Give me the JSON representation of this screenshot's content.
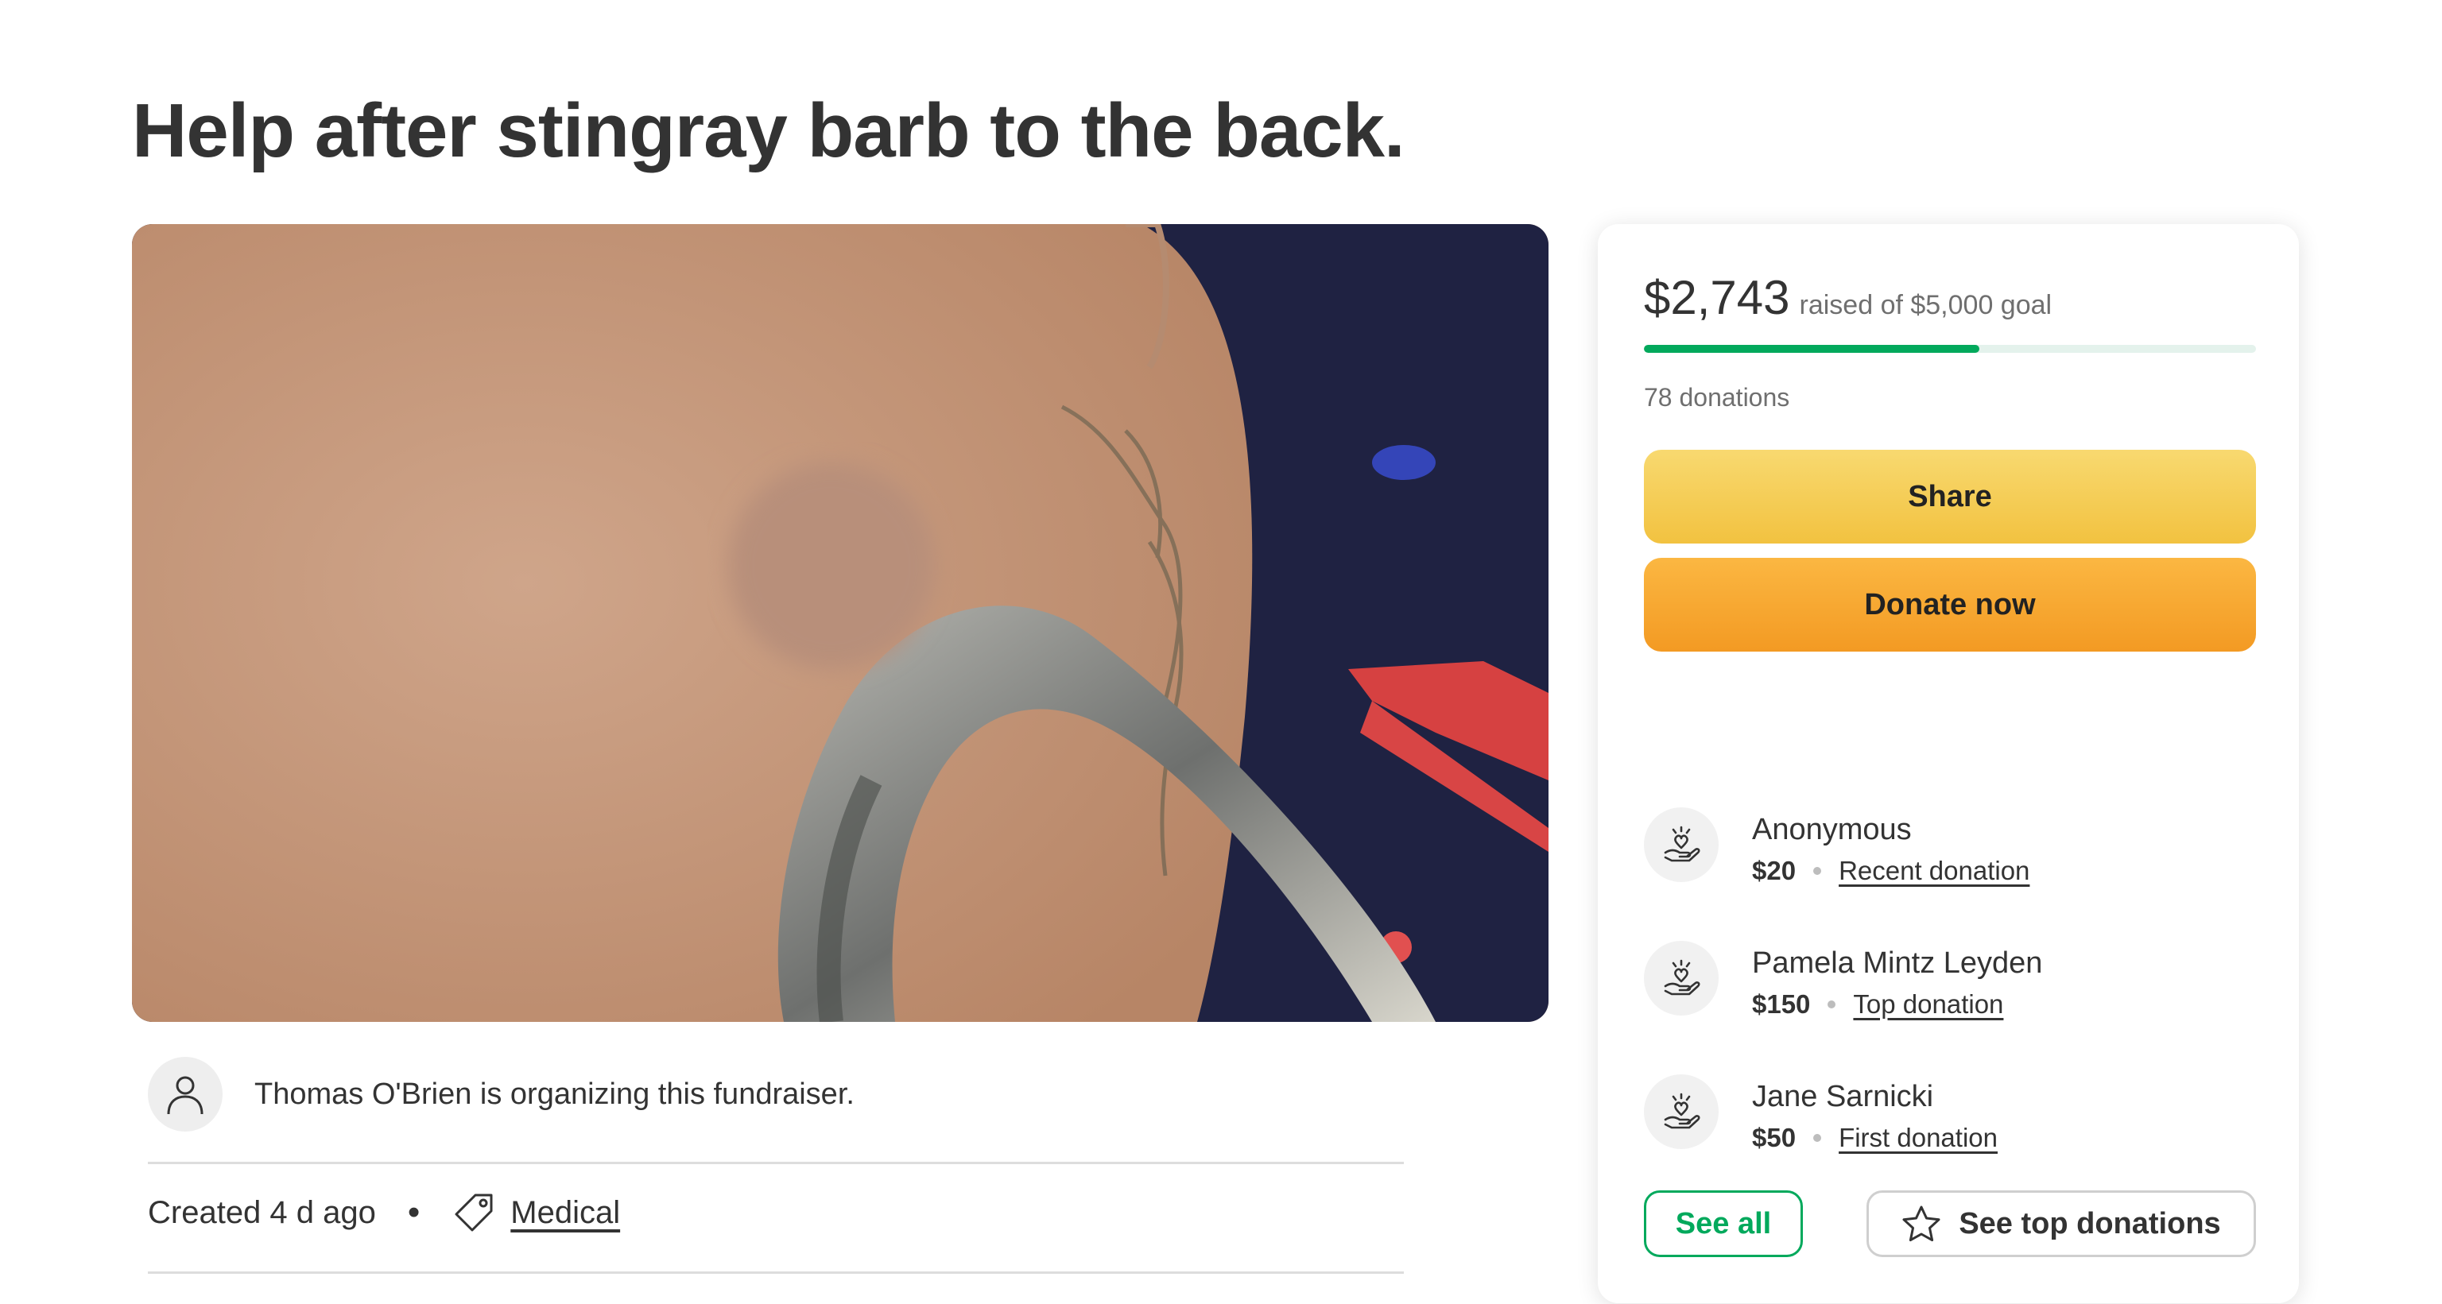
{
  "page": {
    "title": "Help after stingray barb to the back."
  },
  "hero": {
    "alt": "stingray barb photo",
    "colors": {
      "skin": "#c99d82",
      "background": "#1e2140",
      "barb": "#8a8c8a",
      "rail": "#d84040"
    }
  },
  "organizer": {
    "text": "Thomas O'Brien is organizing this fundraiser.",
    "icon": "person-icon"
  },
  "meta": {
    "created": "Created 4 d ago",
    "separator": "•",
    "category": "Medical",
    "category_icon": "tag-icon"
  },
  "donation_card": {
    "raised_amount": "$2,743",
    "raised_label": "raised of $5,000 goal",
    "progress_fraction": 0.5486,
    "donations_count": "78 donations",
    "share_label": "Share",
    "donate_label": "Donate now",
    "donors": [
      {
        "name": "Anonymous",
        "amount": "$20",
        "type": "Recent donation",
        "icon": "heart-hand-icon"
      },
      {
        "name": "Pamela Mintz Leyden",
        "amount": "$150",
        "type": "Top donation",
        "icon": "heart-hand-icon"
      },
      {
        "name": "Jane Sarnicki",
        "amount": "$50",
        "type": "First donation",
        "icon": "heart-hand-icon"
      }
    ],
    "see_all_label": "See all",
    "see_top_label": "See top donations",
    "colors": {
      "accent_green": "#02a95c",
      "share_yellow": "#f5cc55",
      "donate_orange": "#f6a833"
    }
  }
}
